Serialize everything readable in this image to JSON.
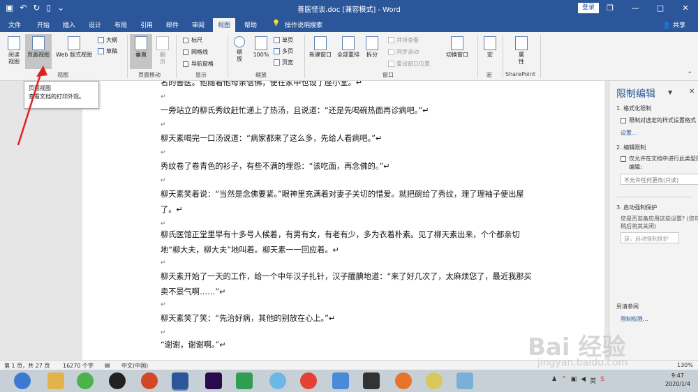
{
  "window": {
    "title": "善医怪谈.doc [兼容模式] - Word",
    "login": "登录",
    "minimize": "—",
    "restore": "❐",
    "maximize": "□",
    "close": "✕"
  },
  "menu": {
    "items": [
      "文件",
      "开始",
      "插入",
      "设计",
      "布局",
      "引用",
      "邮件",
      "审阅",
      "视图",
      "帮助"
    ],
    "active": "视图",
    "tell_me": "操作说明搜索",
    "share": "共享"
  },
  "ribbon": {
    "read_mode": "阅读\n视图",
    "print_layout": "页面视图",
    "web_layout": "Web 版式视图",
    "outline": "大纲",
    "draft": "草稿",
    "group_views": "视图",
    "vertical": "垂直",
    "side_to_side": "翻\n页",
    "group_page_move": "页面移动",
    "ruler": "标尺",
    "gridlines": "网格线",
    "nav_pane": "导航窗格",
    "group_show": "显示",
    "zoom": "缩\n放",
    "zoom100": "100%",
    "one_page": "单页",
    "multi_page": "多页",
    "page_width": "页宽",
    "group_zoom": "缩放",
    "new_window": "新建窗口",
    "arrange_all": "全部重排",
    "split": "拆分",
    "side_by_side": "并排查看",
    "sync_scroll": "同步滚动",
    "reset_pos": "重设窗口位置",
    "switch_window": "切换窗口",
    "group_window": "窗口",
    "macros": "宏",
    "group_macros": "宏",
    "properties": "属\n性",
    "group_sharepoint": "SharePoint"
  },
  "tooltip": {
    "title": "页面视图",
    "desc": "查看文档的打印外观。"
  },
  "document": {
    "paragraphs": [
      "名的善医。他随着他母亲信佛，便在家中也设了座小堂。↵",
      "一旁站立的柳氏秀纹赶忙递上了热汤，且说道：“还是先喝碗热面再诊病吧。”↵",
      "柳天素喝完一口汤说道：“病家都来了这么多，先给人看病吧。”↵",
      "秀纹卷了卷青色的衫子，有些不满的埋怨：“该吃面，再念佛的。”↵",
      "柳天素笑着说：“当然是念佛要紧。”眼神里充满着对妻子关切的惜爱。就把碗给了秀纹，理了理袖子便出屋了。↵",
      "柳氏医馆正堂里早有十多号人候着，有男有女，有老有少，多为衣着朴素。见了柳天素出来，个个都亲切地“柳大夫，柳大夫”地叫着。柳天素一一回应着。↵",
      "柳天素开始了一天的工作，给一个中年汉子扎针，汉子腼腆地道：“来了好几次了，太麻烦您了，最近我那买卖不景气啊……”↵",
      "柳天素笑了笑：“先治好病，其他的别放在心上。”↵",
      "“谢谢，谢谢啊。”↵"
    ],
    "empty_mark": "↵"
  },
  "pane": {
    "title": "限制编辑",
    "section1": "1. 格式化限制",
    "limit_format": "限制对选定的样式设置格式",
    "settings": "设置...",
    "section2": "2. 编辑限制",
    "allow_only": "仅允许在文档中进行此类型的",
    "editing": "编辑:",
    "no_changes": "不允许任何更改(只读)",
    "section3": "3. 启动强制保护",
    "question": "您是否准备应用这些设置? (您可",
    "question2": "稍后将其关闭)",
    "start_btn": "是，启动强制保护",
    "see_also": "另请参阅",
    "restrict_perm": "限制权限..."
  },
  "status": {
    "page": "第 1 页，共 27 页",
    "words": "16270 个字",
    "lang": "中文(中国)",
    "zoom": "130%"
  },
  "taskbar": {
    "time": "9:47",
    "date": "2020/1/4",
    "ime": "英"
  },
  "watermark": {
    "brand": "Bai 经验",
    "url": "jingyan.baidu.com"
  }
}
